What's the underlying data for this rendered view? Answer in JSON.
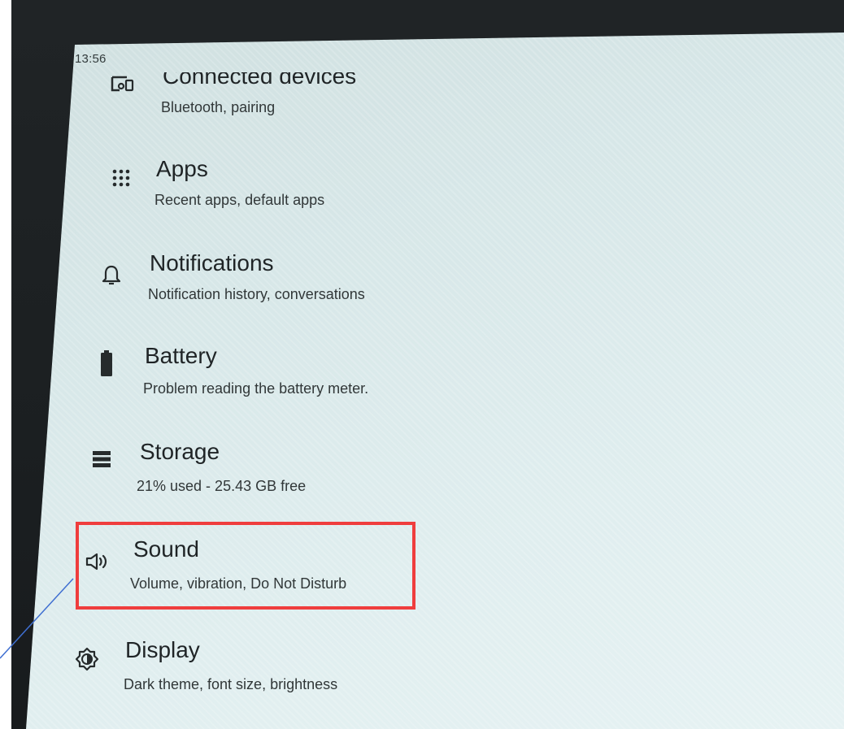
{
  "status_bar": {
    "time": "13:56"
  },
  "settings": {
    "items": [
      {
        "title": "Connected devices",
        "subtitle": "Bluetooth, pairing",
        "icon": "connected-devices-icon"
      },
      {
        "title": "Apps",
        "subtitle": "Recent apps, default apps",
        "icon": "apps-grid-icon"
      },
      {
        "title": "Notifications",
        "subtitle": "Notification history, conversations",
        "icon": "bell-icon"
      },
      {
        "title": "Battery",
        "subtitle": "Problem reading the battery meter.",
        "icon": "battery-icon"
      },
      {
        "title": "Storage",
        "subtitle": "21% used - 25.43 GB free",
        "icon": "storage-icon"
      },
      {
        "title": "Sound",
        "subtitle": "Volume, vibration, Do Not Disturb",
        "icon": "speaker-icon"
      },
      {
        "title": "Display",
        "subtitle": "Dark theme, font size, brightness",
        "icon": "brightness-icon"
      }
    ]
  },
  "annotation": {
    "highlight_color": "#ef3d3d",
    "pointer_color": "#3f6fd1"
  }
}
